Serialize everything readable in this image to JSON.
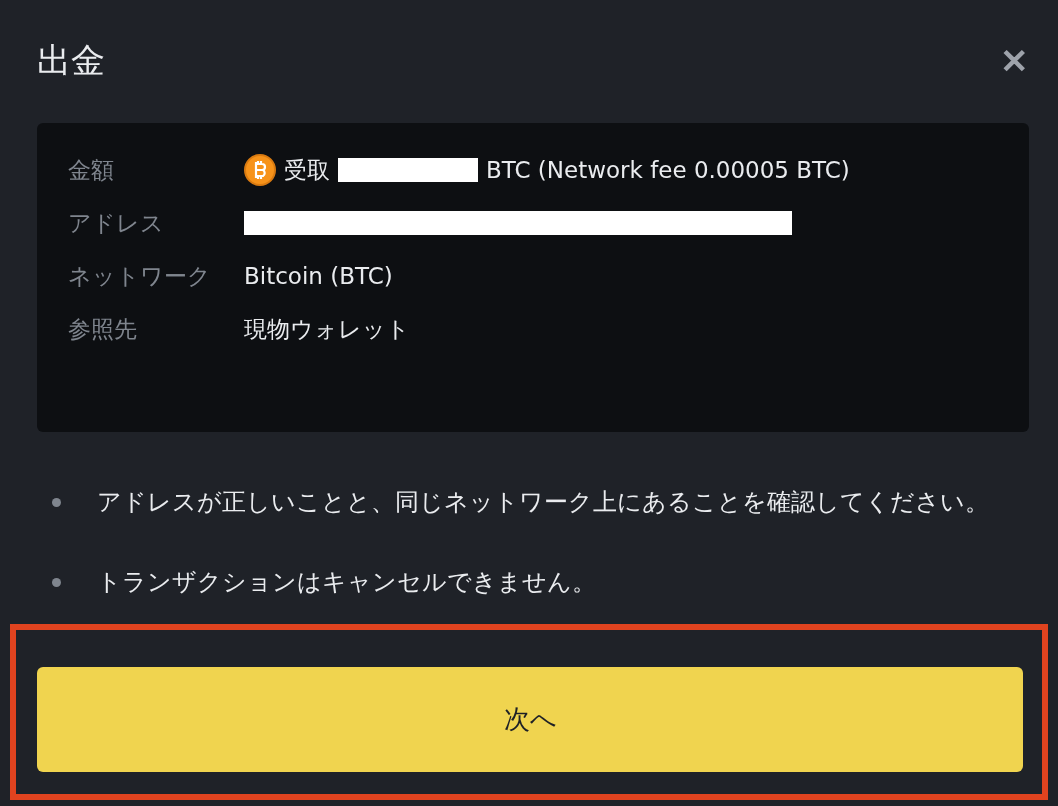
{
  "dialog": {
    "title": "出金",
    "close": "✕"
  },
  "details": [
    {
      "label": "金額",
      "kind": "amount",
      "prefix": "受取",
      "value": "BTC (Network fee 0.00005 BTC)"
    },
    {
      "label": "アドレス",
      "kind": "redacted"
    },
    {
      "label": "ネットワーク",
      "kind": "text",
      "value": "Bitcoin (BTC)"
    },
    {
      "label": "参照先",
      "kind": "text",
      "value": "現物ウォレット"
    }
  ],
  "notes": [
    "アドレスが正しいことと、同じネットワーク上にあることを確認してください。",
    "トランザクションはキャンセルできません。"
  ],
  "button": {
    "label": "次へ",
    "highlighted": true
  }
}
